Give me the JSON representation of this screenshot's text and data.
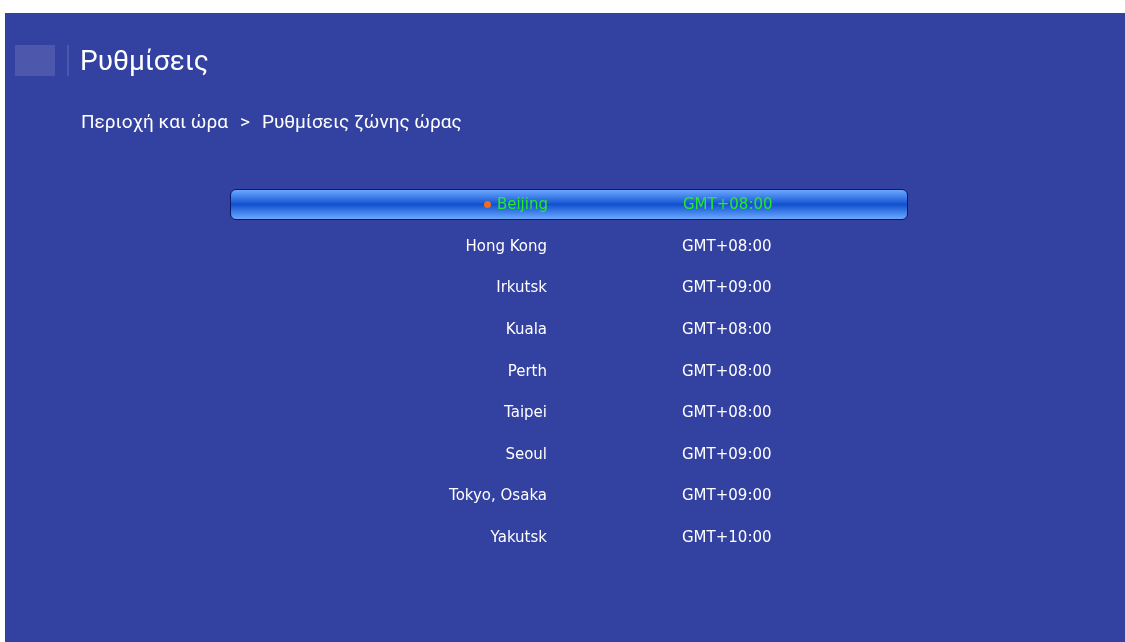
{
  "header": {
    "title": "Ρυθμίσεις"
  },
  "breadcrumb": {
    "parent": "Περιοχή και ώρα",
    "separator": ">",
    "current": "Ρυθμίσεις ζώνης ώρας"
  },
  "timezones": [
    {
      "city": "Beijing",
      "offset": "GMT+08:00",
      "selected": true
    },
    {
      "city": "Hong Kong",
      "offset": "GMT+08:00",
      "selected": false
    },
    {
      "city": "Irkutsk",
      "offset": "GMT+09:00",
      "selected": false
    },
    {
      "city": "Kuala",
      "offset": "GMT+08:00",
      "selected": false
    },
    {
      "city": "Perth",
      "offset": "GMT+08:00",
      "selected": false
    },
    {
      "city": "Taipei",
      "offset": "GMT+08:00",
      "selected": false
    },
    {
      "city": "Seoul",
      "offset": "GMT+09:00",
      "selected": false
    },
    {
      "city": "Tokyo, Osaka",
      "offset": "GMT+09:00",
      "selected": false
    },
    {
      "city": "Yakutsk",
      "offset": "GMT+10:00",
      "selected": false
    }
  ]
}
